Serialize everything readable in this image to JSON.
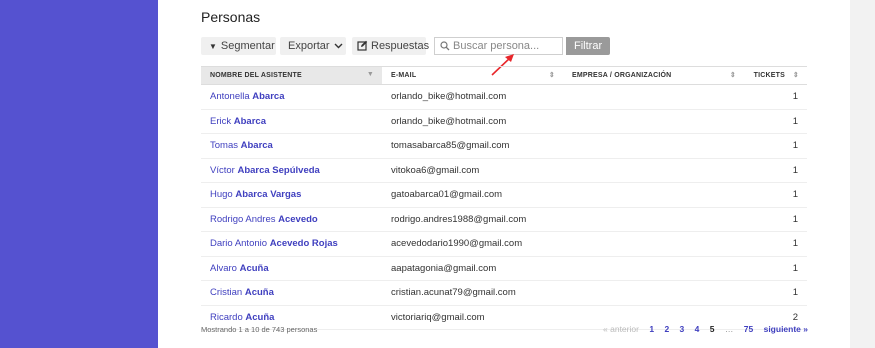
{
  "page": {
    "title": "Personas"
  },
  "toolbar": {
    "segment_label": "Segmentar",
    "export_label": "Exportar",
    "responses_label": "Respuestas",
    "search_placeholder": "Buscar persona...",
    "filter_label": "Filtrar"
  },
  "table": {
    "columns": [
      "NOMBRE DEL ASISTENTE",
      "E-MAIL",
      "EMPRESA / ORGANIZACIÓN",
      "TICKETS"
    ],
    "rows": [
      {
        "first": "Antonella",
        "last": "Abarca",
        "email": "orlando_bike@hotmail.com",
        "company": "",
        "tickets": "1"
      },
      {
        "first": "Erick",
        "last": "Abarca",
        "email": "orlando_bike@hotmail.com",
        "company": "",
        "tickets": "1"
      },
      {
        "first": "Tomas",
        "last": "Abarca",
        "email": "tomasabarca85@gmail.com",
        "company": "",
        "tickets": "1"
      },
      {
        "first": "Víctor",
        "last": "Abarca Sepúlveda",
        "email": "vitokoa6@gmail.com",
        "company": "",
        "tickets": "1"
      },
      {
        "first": "Hugo",
        "last": "Abarca Vargas",
        "email": "gatoabarca01@gmail.com",
        "company": "",
        "tickets": "1"
      },
      {
        "first": "Rodrigo Andres",
        "last": "Acevedo",
        "email": "rodrigo.andres1988@gmail.com",
        "company": "",
        "tickets": "1"
      },
      {
        "first": "Dario Antonio",
        "last": "Acevedo Rojas",
        "email": "acevedodario1990@gmail.com",
        "company": "",
        "tickets": "1"
      },
      {
        "first": "Alvaro",
        "last": "Acuña",
        "email": "aapatagonia@gmail.com",
        "company": "",
        "tickets": "1"
      },
      {
        "first": "Cristian",
        "last": "Acuña",
        "email": "cristian.acunat79@gmail.com",
        "company": "",
        "tickets": "1"
      },
      {
        "first": "Ricardo",
        "last": "Acuña",
        "email": "victoriariq@gmail.com",
        "company": "",
        "tickets": "2"
      }
    ]
  },
  "footer": {
    "summary": "Mostrando 1 a 10 de 743 personas",
    "prev": "« anterior",
    "pages": [
      "1",
      "2",
      "3",
      "4",
      "5"
    ],
    "current_page": "5",
    "ellipsis": "…",
    "last_page": "75",
    "next": "siguiente »"
  },
  "colors": {
    "sidebar": "#5552d0",
    "link": "#3f3fbf",
    "filter_button": "#9a9a9a",
    "annotation_arrow": "#e8262b"
  },
  "icons": {
    "segment": "caret-down-icon",
    "export": "chevron-down-icon",
    "responses": "edit-icon",
    "search": "search-icon",
    "sort": "sort-icon"
  }
}
